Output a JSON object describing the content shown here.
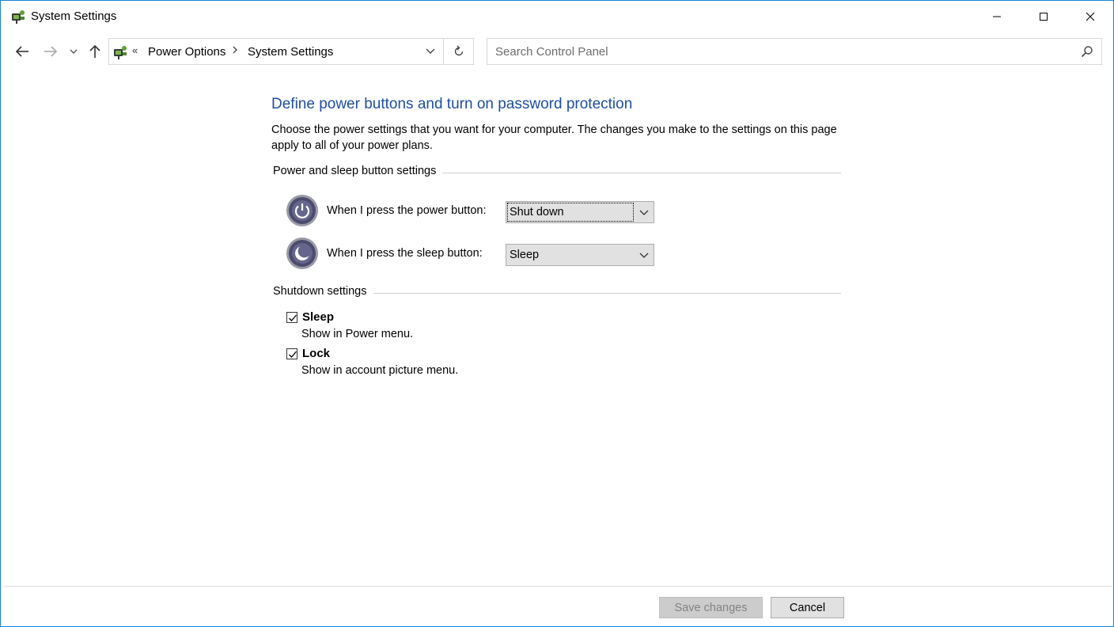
{
  "window": {
    "title": "System Settings",
    "icon": "power-options-icon",
    "accent_color": "#1883d7"
  },
  "navigation": {
    "breadcrumb_overflow": "«",
    "breadcrumbs": [
      "Power Options",
      "System Settings"
    ],
    "search_placeholder": "Search Control Panel"
  },
  "main": {
    "title": "Define power buttons and turn on password protection",
    "title_color": "#1e4fa4",
    "description": "Choose the power settings that you want for your computer. The changes you make to the settings on this page apply to all of your power plans.",
    "power_sleep_section": {
      "header": "Power and sleep button settings",
      "settings": [
        {
          "label": "When I press the power button:",
          "value": "Shut down",
          "icon": "power-button-icon"
        },
        {
          "label": "When I press the sleep button:",
          "value": "Sleep",
          "icon": "sleep-button-icon"
        }
      ]
    },
    "shutdown_section": {
      "header": "Shutdown settings",
      "options": [
        {
          "label": "Sleep",
          "description": "Show in Power menu.",
          "checked": true
        },
        {
          "label": "Lock",
          "description": "Show in account picture menu.",
          "checked": true
        }
      ]
    }
  },
  "footer": {
    "save_label": "Save changes",
    "save_enabled": false,
    "cancel_label": "Cancel"
  }
}
